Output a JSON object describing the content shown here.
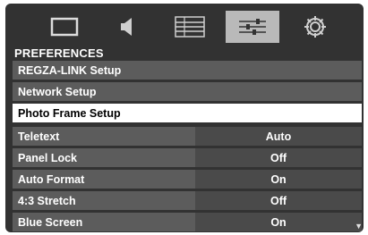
{
  "menu": {
    "tabs": [
      {
        "icon": "picture-icon",
        "active": false
      },
      {
        "icon": "sound-icon",
        "active": false
      },
      {
        "icon": "setup-list-icon",
        "active": false
      },
      {
        "icon": "preferences-sliders-icon",
        "active": true
      },
      {
        "icon": "settings-gear-icon",
        "active": false
      }
    ],
    "section_title": "PREFERENCES",
    "items": [
      {
        "label": "REGZA-LINK Setup"
      },
      {
        "label": "Network Setup"
      },
      {
        "label": "Photo Frame Setup",
        "selected": true
      },
      {
        "label": "Teletext",
        "value": "Auto"
      },
      {
        "label": "Panel Lock",
        "value": "Off"
      },
      {
        "label": "Auto Format",
        "value": "On"
      },
      {
        "label": "4:3 Stretch",
        "value": "Off"
      },
      {
        "label": "Blue Screen",
        "value": "On"
      }
    ],
    "scroll_indicator": "▼"
  },
  "colors": {
    "background": "#323232",
    "row": "#5c5c5c",
    "value_cell": "#4a4a4a",
    "selected_row": "#ffffff",
    "active_tab": "#b9b9b9"
  }
}
